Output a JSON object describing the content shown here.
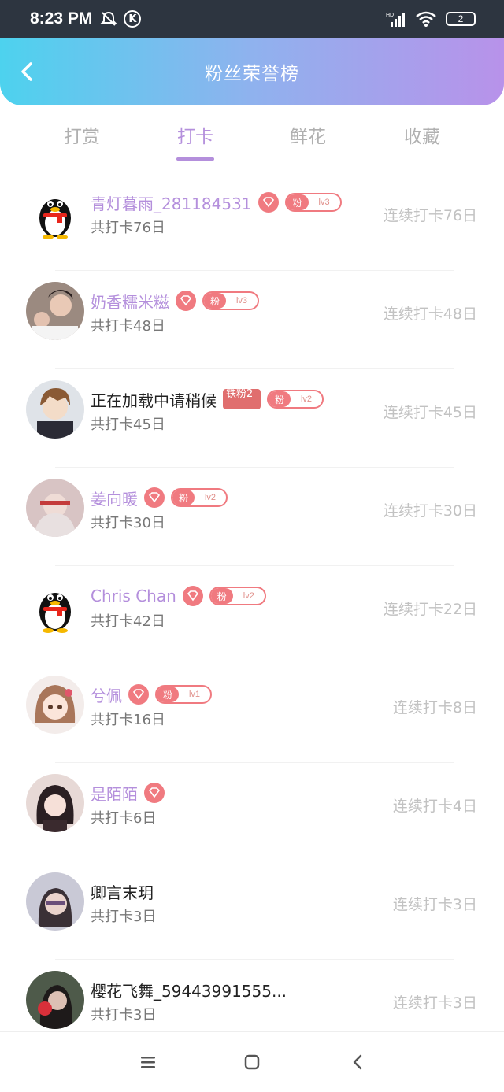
{
  "status_bar": {
    "time": "8:23 PM",
    "k_label": "K",
    "hd_label": "HD",
    "battery": "2"
  },
  "header": {
    "title": "粉丝荣誉榜"
  },
  "tabs": [
    {
      "label": "打赏",
      "active": false
    },
    {
      "label": "打卡",
      "active": true
    },
    {
      "label": "鲜花",
      "active": false
    },
    {
      "label": "收藏",
      "active": false
    }
  ],
  "fan_badge_label": "粉",
  "rows": [
    {
      "name": "青灯暮雨_281184531",
      "total": "共打卡76日",
      "streak": "连续打卡76日",
      "level": "lv3",
      "avatar": "qq-penguin"
    },
    {
      "name": "奶香糯米糍",
      "total": "共打卡48日",
      "streak": "连续打卡48日",
      "level": "lv3",
      "avatar": "photo"
    },
    {
      "name": "正在加载中请稍候",
      "total": "共打卡45日",
      "streak": "连续打卡45日",
      "level": "lv2",
      "iron_badge": "铁粉2",
      "avatar": "anime"
    },
    {
      "name": "姜向暖",
      "total": "共打卡30日",
      "streak": "连续打卡30日",
      "level": "lv2",
      "avatar": "photo"
    },
    {
      "name": "Chris Chan",
      "total": "共打卡42日",
      "streak": "连续打卡22日",
      "level": "lv2",
      "avatar": "qq-penguin"
    },
    {
      "name": "兮佩",
      "total": "共打卡16日",
      "streak": "连续打卡8日",
      "level": "lv1",
      "avatar": "anime"
    },
    {
      "name": "是陌陌",
      "total": "共打卡6日",
      "streak": "连续打卡4日",
      "avatar": "anime"
    },
    {
      "name": "卿言末玥",
      "total": "共打卡3日",
      "streak": "连续打卡3日",
      "avatar": "photo"
    },
    {
      "name": "樱花飞舞_59443991555...",
      "total": "共打卡3日",
      "streak": "连续打卡3日",
      "avatar": "photo"
    }
  ],
  "colors": {
    "accent": "#b48fdc",
    "badge": "#f07a80",
    "header_start": "#4dd2ee",
    "header_end": "#b892ea"
  }
}
